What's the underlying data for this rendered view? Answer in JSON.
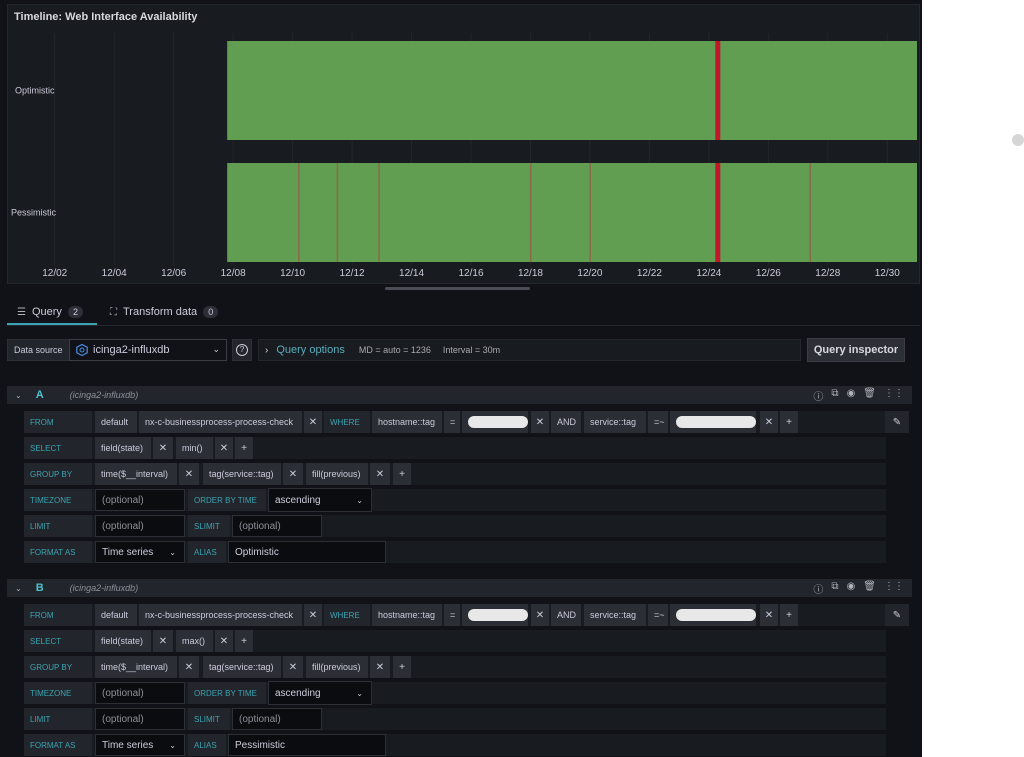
{
  "panel": {
    "title": "Timeline: Web Interface Availability",
    "rows": [
      "Optimistic",
      "Pessimistic"
    ]
  },
  "chart_data": {
    "type": "state-timeline",
    "x_tick_labels": [
      "12/02",
      "12/04",
      "12/06",
      "12/08",
      "12/10",
      "12/12",
      "12/14",
      "12/16",
      "12/18",
      "12/20",
      "12/22",
      "12/24",
      "12/26",
      "12/28",
      "12/30"
    ],
    "ok_color": "#629e51",
    "critical_color": "#c4162a",
    "series": [
      {
        "name": "Optimistic",
        "critical_markers_day": [
          24.3
        ],
        "boundary_markers_day": []
      },
      {
        "name": "Pessimistic",
        "critical_markers_day": [
          24.3
        ],
        "boundary_markers_day": [
          10.2,
          11.5,
          12.9,
          18.0,
          20.0,
          27.4
        ]
      }
    ],
    "data_start_day": 7.8,
    "x_range_day": [
      1,
      31
    ]
  },
  "tabs": [
    {
      "label": "Query",
      "count": "2"
    },
    {
      "label": "Transform data",
      "count": "0"
    }
  ],
  "toolbar": {
    "ds_label": "Data source",
    "ds_name": "icinga2-influxdb",
    "query_options": "Query options",
    "md": "MD = auto = 1236",
    "interval": "Interval = 30m",
    "inspector": "Query inspector"
  },
  "queries": [
    {
      "id": "A",
      "ds": "(icinga2-influxdb)",
      "kw": {
        "from": "FROM",
        "where": "WHERE",
        "and": "AND",
        "select": "SELECT",
        "groupby": "GROUP BY",
        "timezone": "TIMEZONE",
        "orderby": "ORDER BY TIME",
        "limit": "LIMIT",
        "slimit": "SLIMIT",
        "format": "FORMAT AS",
        "alias": "ALIAS"
      },
      "from_policy": "default",
      "measurement": "nx-c-businessprocess-process-check",
      "tag1": "hostname::tag",
      "op1": "=",
      "tag2": "service::tag",
      "op2": "=~",
      "field": "field(state)",
      "func": "min()",
      "group1": "time($__interval)",
      "group2": "tag(service::tag)",
      "group3": "fill(previous)",
      "timezone_ph": "(optional)",
      "order": "ascending",
      "limit_ph": "(optional)",
      "slimit_ph": "(optional)",
      "format": "Time series",
      "alias": "Optimistic"
    },
    {
      "id": "B",
      "ds": "(icinga2-influxdb)",
      "kw": {
        "from": "FROM",
        "where": "WHERE",
        "and": "AND",
        "select": "SELECT",
        "groupby": "GROUP BY",
        "timezone": "TIMEZONE",
        "orderby": "ORDER BY TIME",
        "limit": "LIMIT",
        "slimit": "SLIMIT",
        "format": "FORMAT AS",
        "alias": "ALIAS"
      },
      "from_policy": "default",
      "measurement": "nx-c-businessprocess-process-check",
      "tag1": "hostname::tag",
      "op1": "=",
      "tag2": "service::tag",
      "op2": "=~",
      "field": "field(state)",
      "func": "max()",
      "group1": "time($__interval)",
      "group2": "tag(service::tag)",
      "group3": "fill(previous)",
      "timezone_ph": "(optional)",
      "order": "ascending",
      "limit_ph": "(optional)",
      "slimit_ph": "(optional)",
      "format": "Time series",
      "alias": "Pessimistic"
    }
  ],
  "icons": {
    "x": "✕",
    "plus": "+",
    "caret": "⌄",
    "chev_right": "›",
    "chev_down": "⌄",
    "help": "?",
    "pencil": "✎"
  }
}
